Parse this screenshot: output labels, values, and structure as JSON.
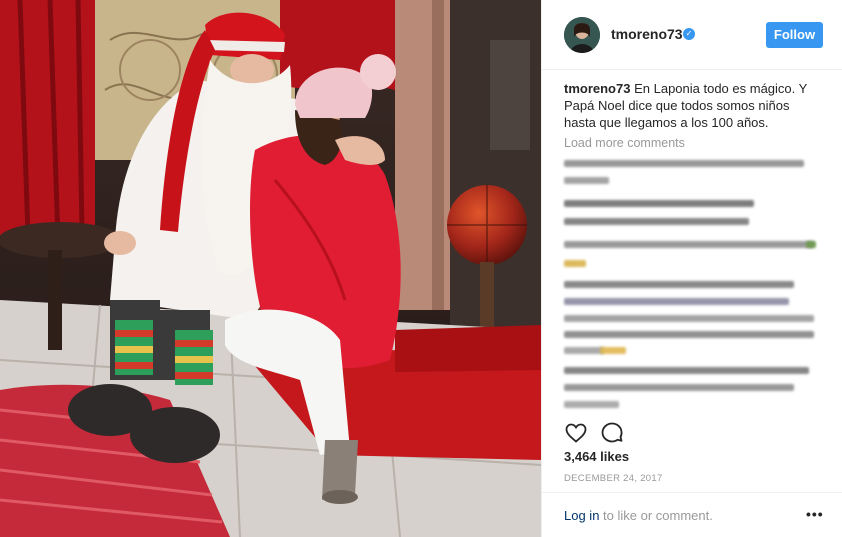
{
  "post": {
    "username": "tmoreno73",
    "verified_glyph": "✓",
    "follow_label": "Follow",
    "caption_user": "tmoreno73",
    "caption_text": "En Laponia todo es mágico. Y Papá Noel dice que todos somos niños hasta que llegamos a los 100 años.",
    "load_more_label": "Load more comments",
    "likes_text": "3,464 likes",
    "date_text": "DECEMBER 24, 2017",
    "login_link_label": "Log in",
    "login_suffix": " to like or comment.",
    "more_glyph": "•••"
  },
  "icons": {
    "like": "heart-icon",
    "comment": "comment-icon",
    "verified": "verified-badge-icon",
    "options": "more-options-icon"
  },
  "colors": {
    "follow_button": "#3897f0",
    "link": "#003569",
    "muted_text": "#999999",
    "border": "#efefef"
  }
}
